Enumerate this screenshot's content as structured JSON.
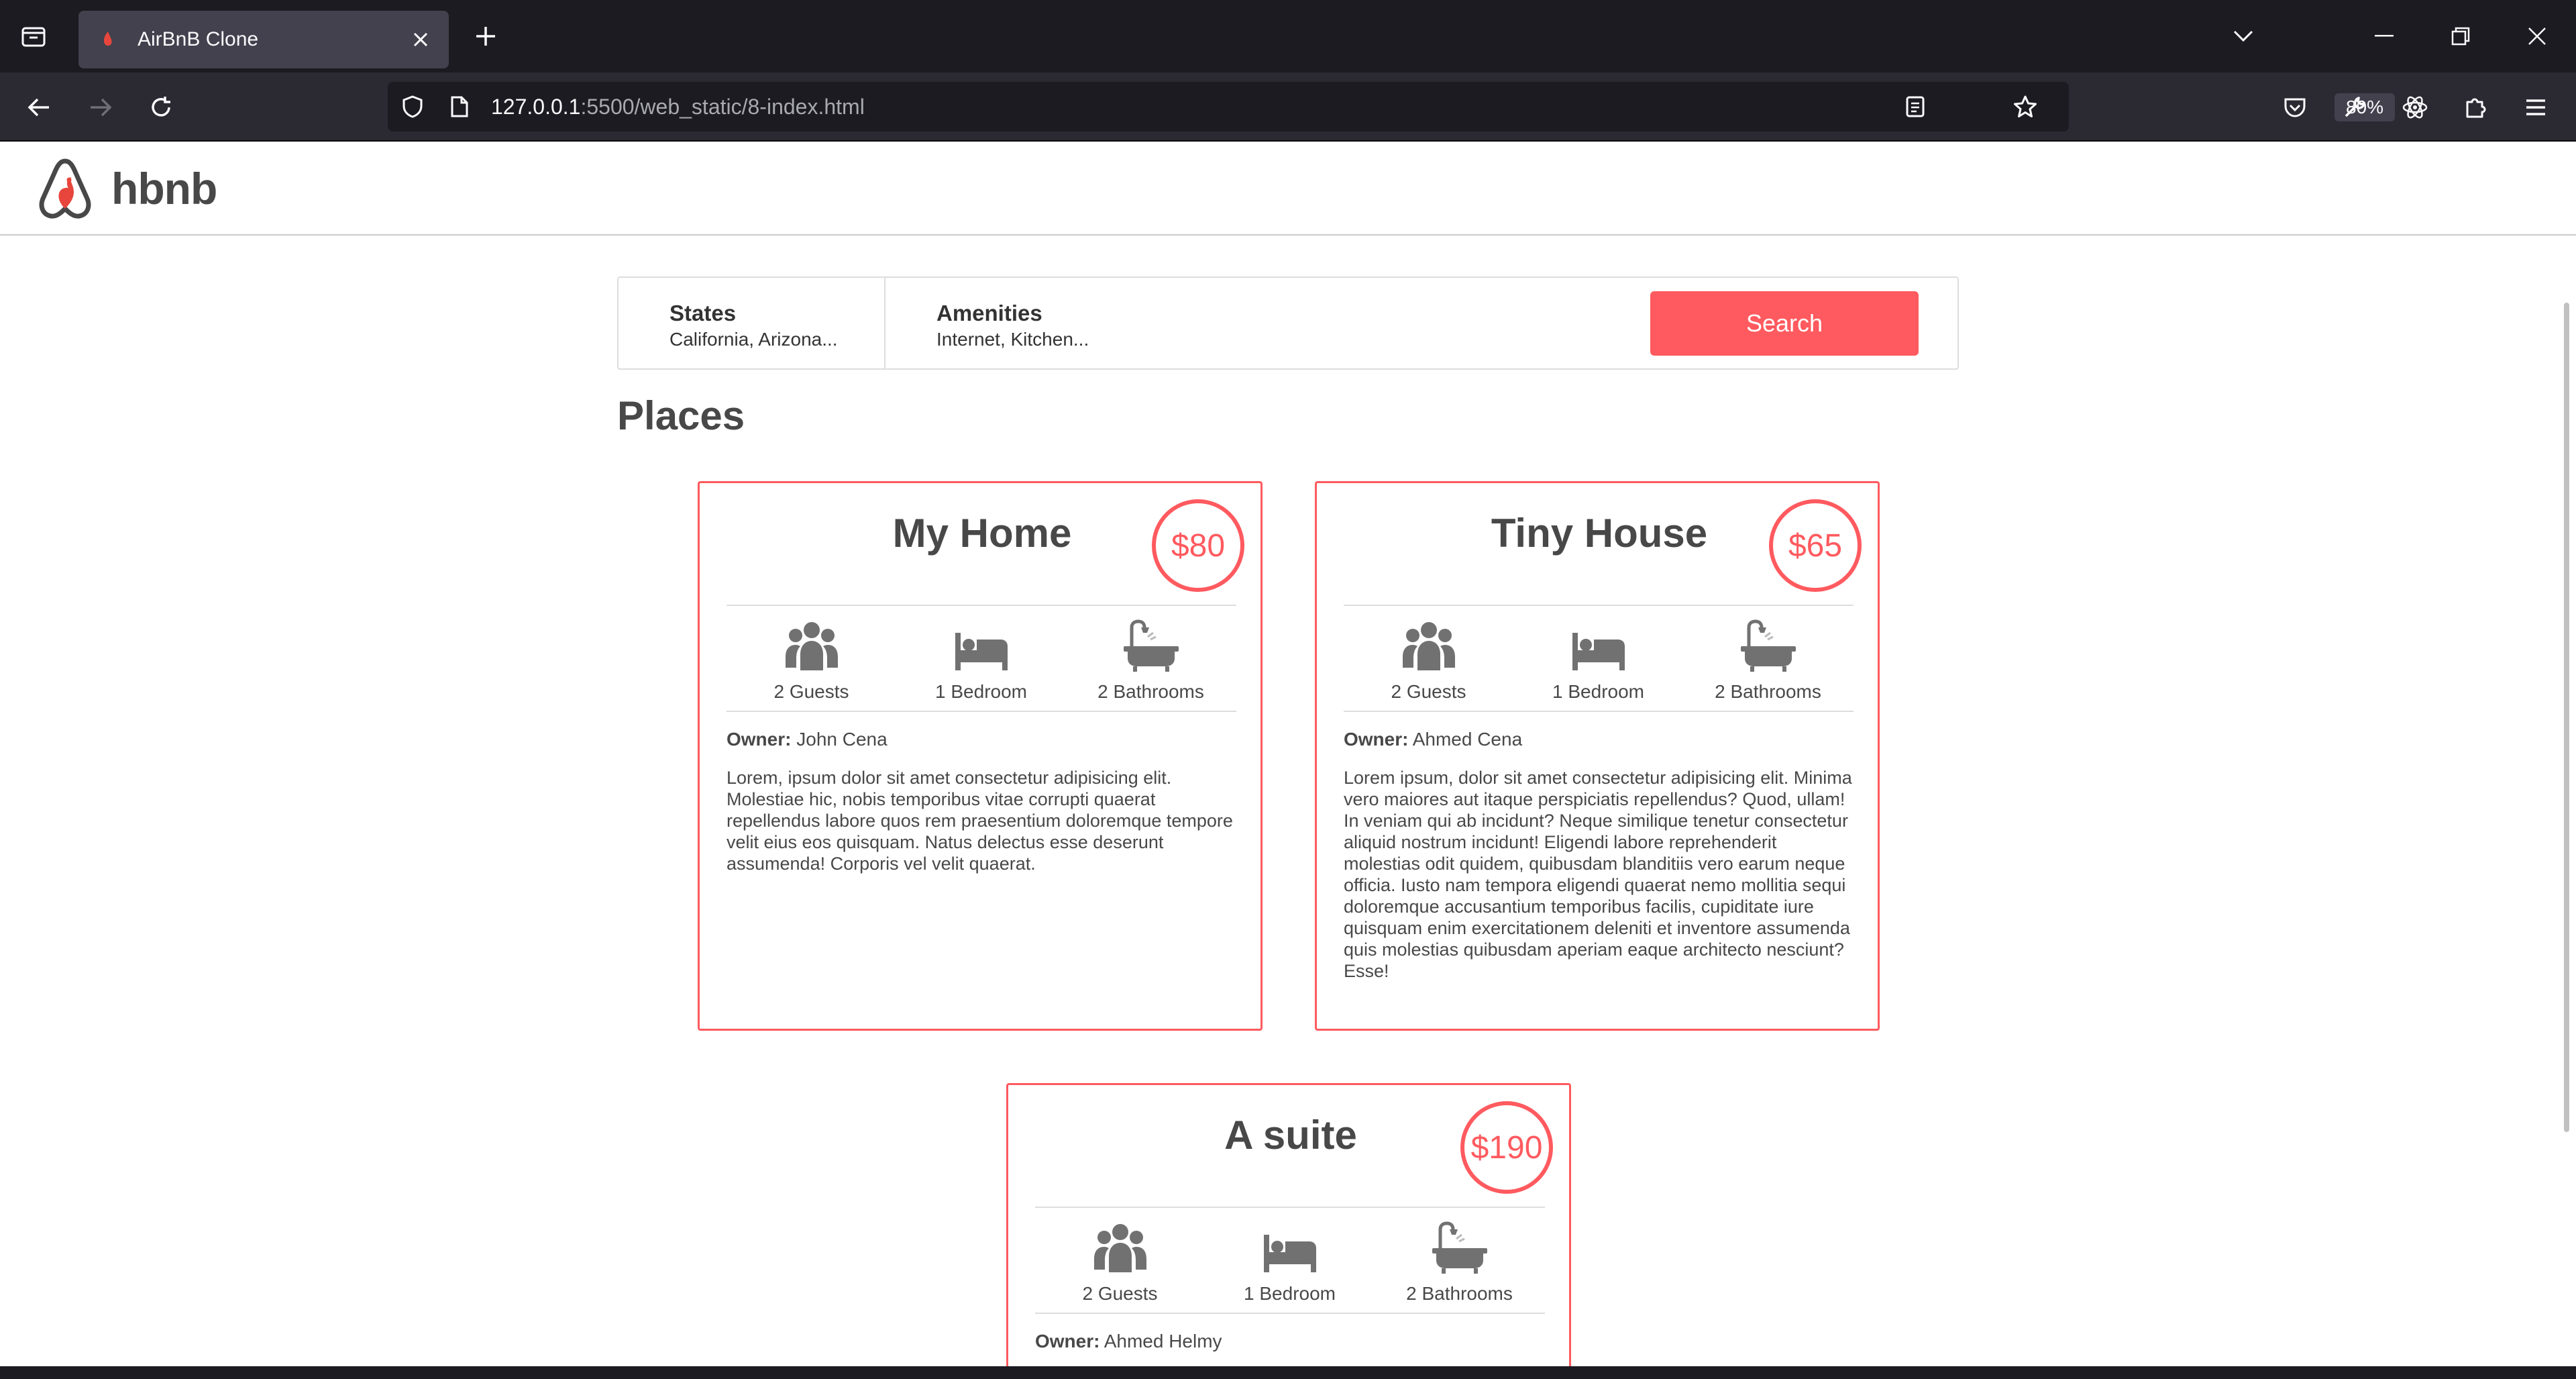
{
  "browser": {
    "tab_title": "AirBnB Clone",
    "url_host": "127.0.0.1",
    "url_path": ":5500/web_static/8-index.html",
    "zoom": "80%"
  },
  "header": {
    "logo_text": "hbnb"
  },
  "filters": {
    "states_title": "States",
    "states_value": "California, Arizona...",
    "amenities_title": "Amenities",
    "amenities_value": "Internet, Kitchen...",
    "search_label": "Search"
  },
  "places_title": "Places",
  "owner_label": "Owner:",
  "places": [
    {
      "name": "My Home",
      "price": "$80",
      "guests": "2 Guests",
      "bedrooms": "1 Bedroom",
      "bathrooms": "2 Bathrooms",
      "owner": "John Cena",
      "description": "Lorem, ipsum dolor sit amet consectetur adipisicing elit. Molestiae hic, nobis temporibus vitae corrupti quaerat repellendus labore quos rem praesentium doloremque tempore velit eius eos quisquam. Natus delectus esse deserunt assumenda! Corporis vel velit quaerat."
    },
    {
      "name": "Tiny House",
      "price": "$65",
      "guests": "2 Guests",
      "bedrooms": "1 Bedroom",
      "bathrooms": "2 Bathrooms",
      "owner": "Ahmed Cena",
      "description": "Lorem ipsum, dolor sit amet consectetur adipisicing elit. Minima vero maiores aut itaque perspiciatis repellendus? Quod, ullam! In veniam qui ab incidunt? Neque similique tenetur consectetur aliquid nostrum incidunt! Eligendi labore reprehenderit molestias odit quidem, quibusdam blanditiis vero earum neque officia. Iusto nam tempora eligendi quaerat nemo mollitia sequi doloremque accusantium temporibus facilis, cupiditate iure quisquam enim exercitationem deleniti et inventore assumenda quis molestias quibusdam aperiam eaque architecto nesciunt? Esse!"
    },
    {
      "name": "A suite",
      "price": "$190",
      "guests": "2 Guests",
      "bedrooms": "1 Bedroom",
      "bathrooms": "2 Bathrooms",
      "owner": "Ahmed Helmy",
      "description": ""
    }
  ],
  "colors": {
    "accent": "#ff5a5f",
    "text": "#484848",
    "chrome_dark": "#1c1b22",
    "chrome_mid": "#2b2a33"
  },
  "icons": [
    "tab-manager-icon",
    "favicon-icon",
    "close-icon",
    "plus-icon",
    "chevron-down-icon",
    "minimize-icon",
    "restore-icon",
    "window-close-icon",
    "back-icon",
    "forward-icon",
    "reload-icon",
    "shield-icon",
    "page-icon",
    "reader-view-icon",
    "star-icon",
    "pocket-icon",
    "wrench-icon",
    "react-devtools-icon",
    "extensions-icon",
    "menu-icon",
    "guests-icon",
    "bed-icon",
    "bath-icon"
  ]
}
